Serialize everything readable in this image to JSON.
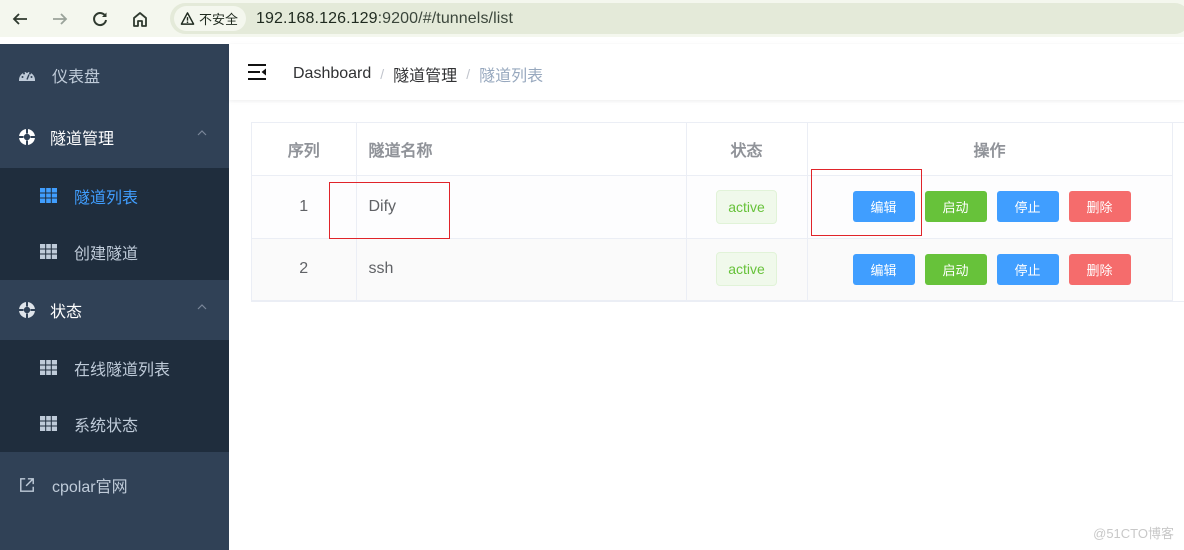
{
  "browser": {
    "security_label": "不安全",
    "url_host": "192.168.126.129",
    "url_rest": ":9200/#/tunnels/list"
  },
  "sidebar": {
    "items": [
      {
        "label": "仪表盘",
        "icon": "dashboard-icon"
      },
      {
        "label": "隧道管理",
        "icon": "lifebuoy-icon",
        "expanded": true,
        "children": [
          {
            "label": "隧道列表",
            "icon": "table-icon",
            "active": true
          },
          {
            "label": "创建隧道",
            "icon": "table-icon"
          }
        ]
      },
      {
        "label": "状态",
        "icon": "lifebuoy-icon",
        "expanded": true,
        "children": [
          {
            "label": "在线隧道列表",
            "icon": "table-icon"
          },
          {
            "label": "系统状态",
            "icon": "table-icon"
          }
        ]
      },
      {
        "label": "cpolar官网",
        "icon": "external-link-icon"
      }
    ]
  },
  "breadcrumb": [
    "Dashboard",
    "隧道管理",
    "隧道列表"
  ],
  "table": {
    "columns": [
      "序列",
      "隧道名称",
      "状态",
      "操作"
    ],
    "rows": [
      {
        "index": "1",
        "name": "Dify",
        "status": "active"
      },
      {
        "index": "2",
        "name": "ssh",
        "status": "active"
      }
    ],
    "actions": [
      "编辑",
      "启动",
      "停止",
      "删除"
    ]
  },
  "colors": {
    "sidebar_bg": "#304156",
    "submenu_bg": "#1f2d3d",
    "active": "#409eff",
    "primary": "#409eff",
    "success": "#67c23a",
    "danger": "#f56c6c",
    "annotation": "#e0242a"
  },
  "watermark": "@51CTO博客"
}
